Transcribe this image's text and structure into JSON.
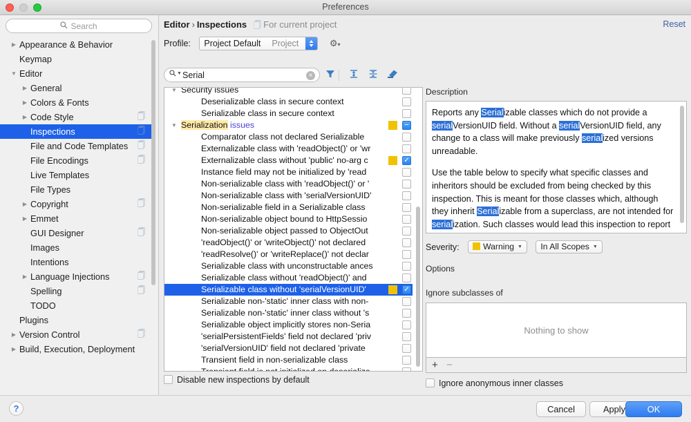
{
  "window": {
    "title": "Preferences",
    "traffic_lights": [
      "close",
      "minimize",
      "zoom"
    ]
  },
  "sidebar": {
    "search": {
      "placeholder": "Search",
      "value": "",
      "icon": "search-icon"
    },
    "items": [
      {
        "label": "Appearance & Behavior",
        "indent": 0,
        "arrow": "collapsed",
        "copy": false,
        "selected": false
      },
      {
        "label": "Keymap",
        "indent": 0,
        "arrow": "none",
        "copy": false,
        "selected": false
      },
      {
        "label": "Editor",
        "indent": 0,
        "arrow": "expanded",
        "copy": false,
        "selected": false
      },
      {
        "label": "General",
        "indent": 1,
        "arrow": "collapsed",
        "copy": false,
        "selected": false
      },
      {
        "label": "Colors & Fonts",
        "indent": 1,
        "arrow": "collapsed",
        "copy": false,
        "selected": false
      },
      {
        "label": "Code Style",
        "indent": 1,
        "arrow": "collapsed",
        "copy": true,
        "selected": false
      },
      {
        "label": "Inspections",
        "indent": 1,
        "arrow": "none",
        "copy": true,
        "selected": true
      },
      {
        "label": "File and Code Templates",
        "indent": 1,
        "arrow": "none",
        "copy": true,
        "selected": false
      },
      {
        "label": "File Encodings",
        "indent": 1,
        "arrow": "none",
        "copy": true,
        "selected": false
      },
      {
        "label": "Live Templates",
        "indent": 1,
        "arrow": "none",
        "copy": false,
        "selected": false
      },
      {
        "label": "File Types",
        "indent": 1,
        "arrow": "none",
        "copy": false,
        "selected": false
      },
      {
        "label": "Copyright",
        "indent": 1,
        "arrow": "collapsed",
        "copy": true,
        "selected": false
      },
      {
        "label": "Emmet",
        "indent": 1,
        "arrow": "collapsed",
        "copy": false,
        "selected": false
      },
      {
        "label": "GUI Designer",
        "indent": 1,
        "arrow": "none",
        "copy": true,
        "selected": false
      },
      {
        "label": "Images",
        "indent": 1,
        "arrow": "none",
        "copy": false,
        "selected": false
      },
      {
        "label": "Intentions",
        "indent": 1,
        "arrow": "none",
        "copy": false,
        "selected": false
      },
      {
        "label": "Language Injections",
        "indent": 1,
        "arrow": "collapsed",
        "copy": true,
        "selected": false
      },
      {
        "label": "Spelling",
        "indent": 1,
        "arrow": "none",
        "copy": true,
        "selected": false
      },
      {
        "label": "TODO",
        "indent": 1,
        "arrow": "none",
        "copy": false,
        "selected": false
      },
      {
        "label": "Plugins",
        "indent": 0,
        "arrow": "none",
        "copy": false,
        "selected": false
      },
      {
        "label": "Version Control",
        "indent": 0,
        "arrow": "collapsed",
        "copy": true,
        "selected": false
      },
      {
        "label": "Build, Execution, Deployment",
        "indent": 0,
        "arrow": "collapsed",
        "copy": false,
        "selected": false
      }
    ]
  },
  "header": {
    "breadcrumb_parent": "Editor",
    "breadcrumb_separator": "›",
    "breadcrumb_current": "Inspections",
    "scope_note": "For current project",
    "scope_icon": "copy-icon",
    "reset_label": "Reset",
    "profile_label": "Profile:",
    "profile_value": "Project Default",
    "profile_scope": "Project",
    "gear_icon": "gear-icon"
  },
  "filter_bar": {
    "search_value": "Serial",
    "search_icon": "search-icon",
    "clear_icon": "clear-icon",
    "buttons": [
      {
        "name": "filter-icon",
        "glyph": "▼"
      },
      {
        "name": "expand-all-icon",
        "glyph": "↧"
      },
      {
        "name": "collapse-all-icon",
        "glyph": "↥"
      },
      {
        "name": "reset-to-defaults-icon",
        "glyph": "▰"
      }
    ]
  },
  "tree": {
    "rows": [
      {
        "label": "Security issues",
        "indent": 0,
        "arrow": "expanded",
        "severity": false,
        "check": "off",
        "selected": false,
        "clipped": true
      },
      {
        "label": "Deserializable class in secure context",
        "indent": 1,
        "arrow": "none",
        "severity": false,
        "check": "off",
        "selected": false
      },
      {
        "label": "Serializable class in secure context",
        "indent": 1,
        "arrow": "none",
        "severity": false,
        "check": "off",
        "selected": false
      },
      {
        "label": "Serialization issues",
        "indent": 0,
        "arrow": "expanded",
        "severity": true,
        "check": "partial",
        "selected": false,
        "highlight_match": "Serialization",
        "highlight_rest": " issues"
      },
      {
        "label": "Comparator class not declared Serializable",
        "indent": 1,
        "arrow": "none",
        "severity": false,
        "check": "off",
        "selected": false
      },
      {
        "label": "Externalizable class with 'readObject()' or 'wr",
        "indent": 1,
        "arrow": "none",
        "severity": false,
        "check": "off",
        "selected": false
      },
      {
        "label": "Externalizable class without 'public' no-arg c",
        "indent": 1,
        "arrow": "none",
        "severity": true,
        "check": "on",
        "selected": false
      },
      {
        "label": "Instance field may not be initialized by 'read",
        "indent": 1,
        "arrow": "none",
        "severity": false,
        "check": "off",
        "selected": false
      },
      {
        "label": "Non-serializable class with 'readObject()' or '",
        "indent": 1,
        "arrow": "none",
        "severity": false,
        "check": "off",
        "selected": false
      },
      {
        "label": "Non-serializable class with 'serialVersionUID'",
        "indent": 1,
        "arrow": "none",
        "severity": false,
        "check": "off",
        "selected": false
      },
      {
        "label": "Non-serializable field in a Serializable class",
        "indent": 1,
        "arrow": "none",
        "severity": false,
        "check": "off",
        "selected": false
      },
      {
        "label": "Non-serializable object bound to HttpSessio",
        "indent": 1,
        "arrow": "none",
        "severity": false,
        "check": "off",
        "selected": false
      },
      {
        "label": "Non-serializable object passed to ObjectOut",
        "indent": 1,
        "arrow": "none",
        "severity": false,
        "check": "off",
        "selected": false
      },
      {
        "label": "'readObject()' or 'writeObject()' not declared",
        "indent": 1,
        "arrow": "none",
        "severity": false,
        "check": "off",
        "selected": false
      },
      {
        "label": "'readResolve()' or 'writeReplace()' not declar",
        "indent": 1,
        "arrow": "none",
        "severity": false,
        "check": "off",
        "selected": false
      },
      {
        "label": "Serializable class with unconstructable ances",
        "indent": 1,
        "arrow": "none",
        "severity": false,
        "check": "off",
        "selected": false
      },
      {
        "label": "Serializable class without 'readObject()' and",
        "indent": 1,
        "arrow": "none",
        "severity": false,
        "check": "off",
        "selected": false
      },
      {
        "label": "Serializable class without 'serialVersionUID'",
        "indent": 1,
        "arrow": "none",
        "severity": true,
        "check": "on",
        "selected": true
      },
      {
        "label": "Serializable non-'static' inner class with non-",
        "indent": 1,
        "arrow": "none",
        "severity": false,
        "check": "off",
        "selected": false
      },
      {
        "label": "Serializable non-'static' inner class without 's",
        "indent": 1,
        "arrow": "none",
        "severity": false,
        "check": "off",
        "selected": false
      },
      {
        "label": "Serializable object implicitly stores non-Seria",
        "indent": 1,
        "arrow": "none",
        "severity": false,
        "check": "off",
        "selected": false
      },
      {
        "label": "'serialPersistentFields' field not declared 'priv",
        "indent": 1,
        "arrow": "none",
        "severity": false,
        "check": "off",
        "selected": false
      },
      {
        "label": "'serialVersionUID' field not declared 'private",
        "indent": 1,
        "arrow": "none",
        "severity": false,
        "check": "off",
        "selected": false
      },
      {
        "label": "Transient field in non-serializable class",
        "indent": 1,
        "arrow": "none",
        "severity": false,
        "check": "off",
        "selected": false
      },
      {
        "label": "Transient field is not initialized on deserializa",
        "indent": 1,
        "arrow": "none",
        "severity": false,
        "check": "off",
        "selected": false
      }
    ],
    "disable_new_label": "Disable new inspections by default",
    "disable_new_checked": false
  },
  "description": {
    "section_title": "Description",
    "paragraphs": [
      [
        {
          "t": "Reports any "
        },
        {
          "t": "Serial",
          "hl": true
        },
        {
          "t": "izable classes which do not provide a "
        },
        {
          "t": "serial",
          "hl": true
        },
        {
          "t": "VersionUID field. Without a "
        },
        {
          "t": "serial",
          "hl": true
        },
        {
          "t": "VersionUID field, any change to a class will make previously "
        },
        {
          "t": "serial",
          "hl": true
        },
        {
          "t": "ized versions unreadable."
        }
      ],
      [
        {
          "t": "Use the table below to specify what specific classes and inheritors should be excluded from being checked by this inspection. This is meant for those classes which, although they inherit "
        },
        {
          "t": "Serial",
          "hl": true
        },
        {
          "t": "izable from a superclass, are not intended for "
        },
        {
          "t": "serial",
          "hl": true
        },
        {
          "t": "ization. Such classes would lead this inspection to report unnecessarily."
        }
      ]
    ]
  },
  "options": {
    "severity_label": "Severity:",
    "severity_value": "Warning",
    "severity_color": "#f2c200",
    "scope_value": "In All Scopes",
    "options_title": "Options",
    "ignore_subclasses_title": "Ignore subclasses of",
    "empty_table_text": "Nothing to show",
    "add_label": "+",
    "remove_label": "−",
    "anonymous_label": "Ignore anonymous inner classes",
    "anonymous_checked": false
  },
  "footer": {
    "help_label": "?",
    "cancel_label": "Cancel",
    "apply_label": "Apply",
    "ok_label": "OK"
  },
  "colors": {
    "accent_blue": "#1e61e8",
    "button_blue": "#2e7bf0",
    "warning_yellow": "#f2c200",
    "match_highlight": "#ffe9a8",
    "desc_highlight": "#2b6fd6",
    "link": "#3b5fa8"
  }
}
